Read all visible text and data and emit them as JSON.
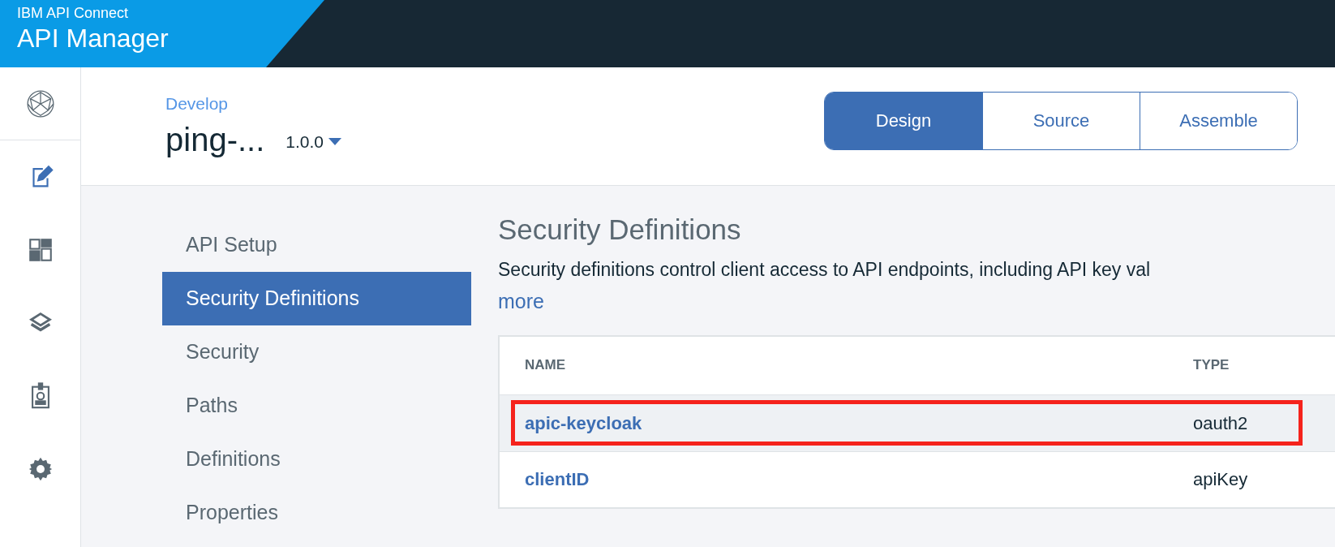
{
  "header": {
    "brand": "IBM API Connect",
    "product": "API Manager"
  },
  "breadcrumb": "Develop",
  "api": {
    "name": "ping-...",
    "version": "1.0.0"
  },
  "tabs": [
    {
      "label": "Design",
      "selected": true
    },
    {
      "label": "Source",
      "selected": false
    },
    {
      "label": "Assemble",
      "selected": false
    }
  ],
  "nav": [
    {
      "label": "API Setup",
      "selected": false
    },
    {
      "label": "Security Definitions",
      "selected": true
    },
    {
      "label": "Security",
      "selected": false
    },
    {
      "label": "Paths",
      "selected": false
    },
    {
      "label": "Definitions",
      "selected": false
    },
    {
      "label": "Properties",
      "selected": false
    }
  ],
  "section": {
    "title": "Security Definitions",
    "description": "Security definitions control client access to API endpoints, including API key val",
    "more_link": "more"
  },
  "table": {
    "columns": [
      "NAME",
      "TYPE"
    ],
    "rows": [
      {
        "name": "apic-keycloak",
        "type": "oauth2",
        "highlighted": true
      },
      {
        "name": "clientID",
        "type": "apiKey",
        "highlighted": false
      }
    ]
  }
}
